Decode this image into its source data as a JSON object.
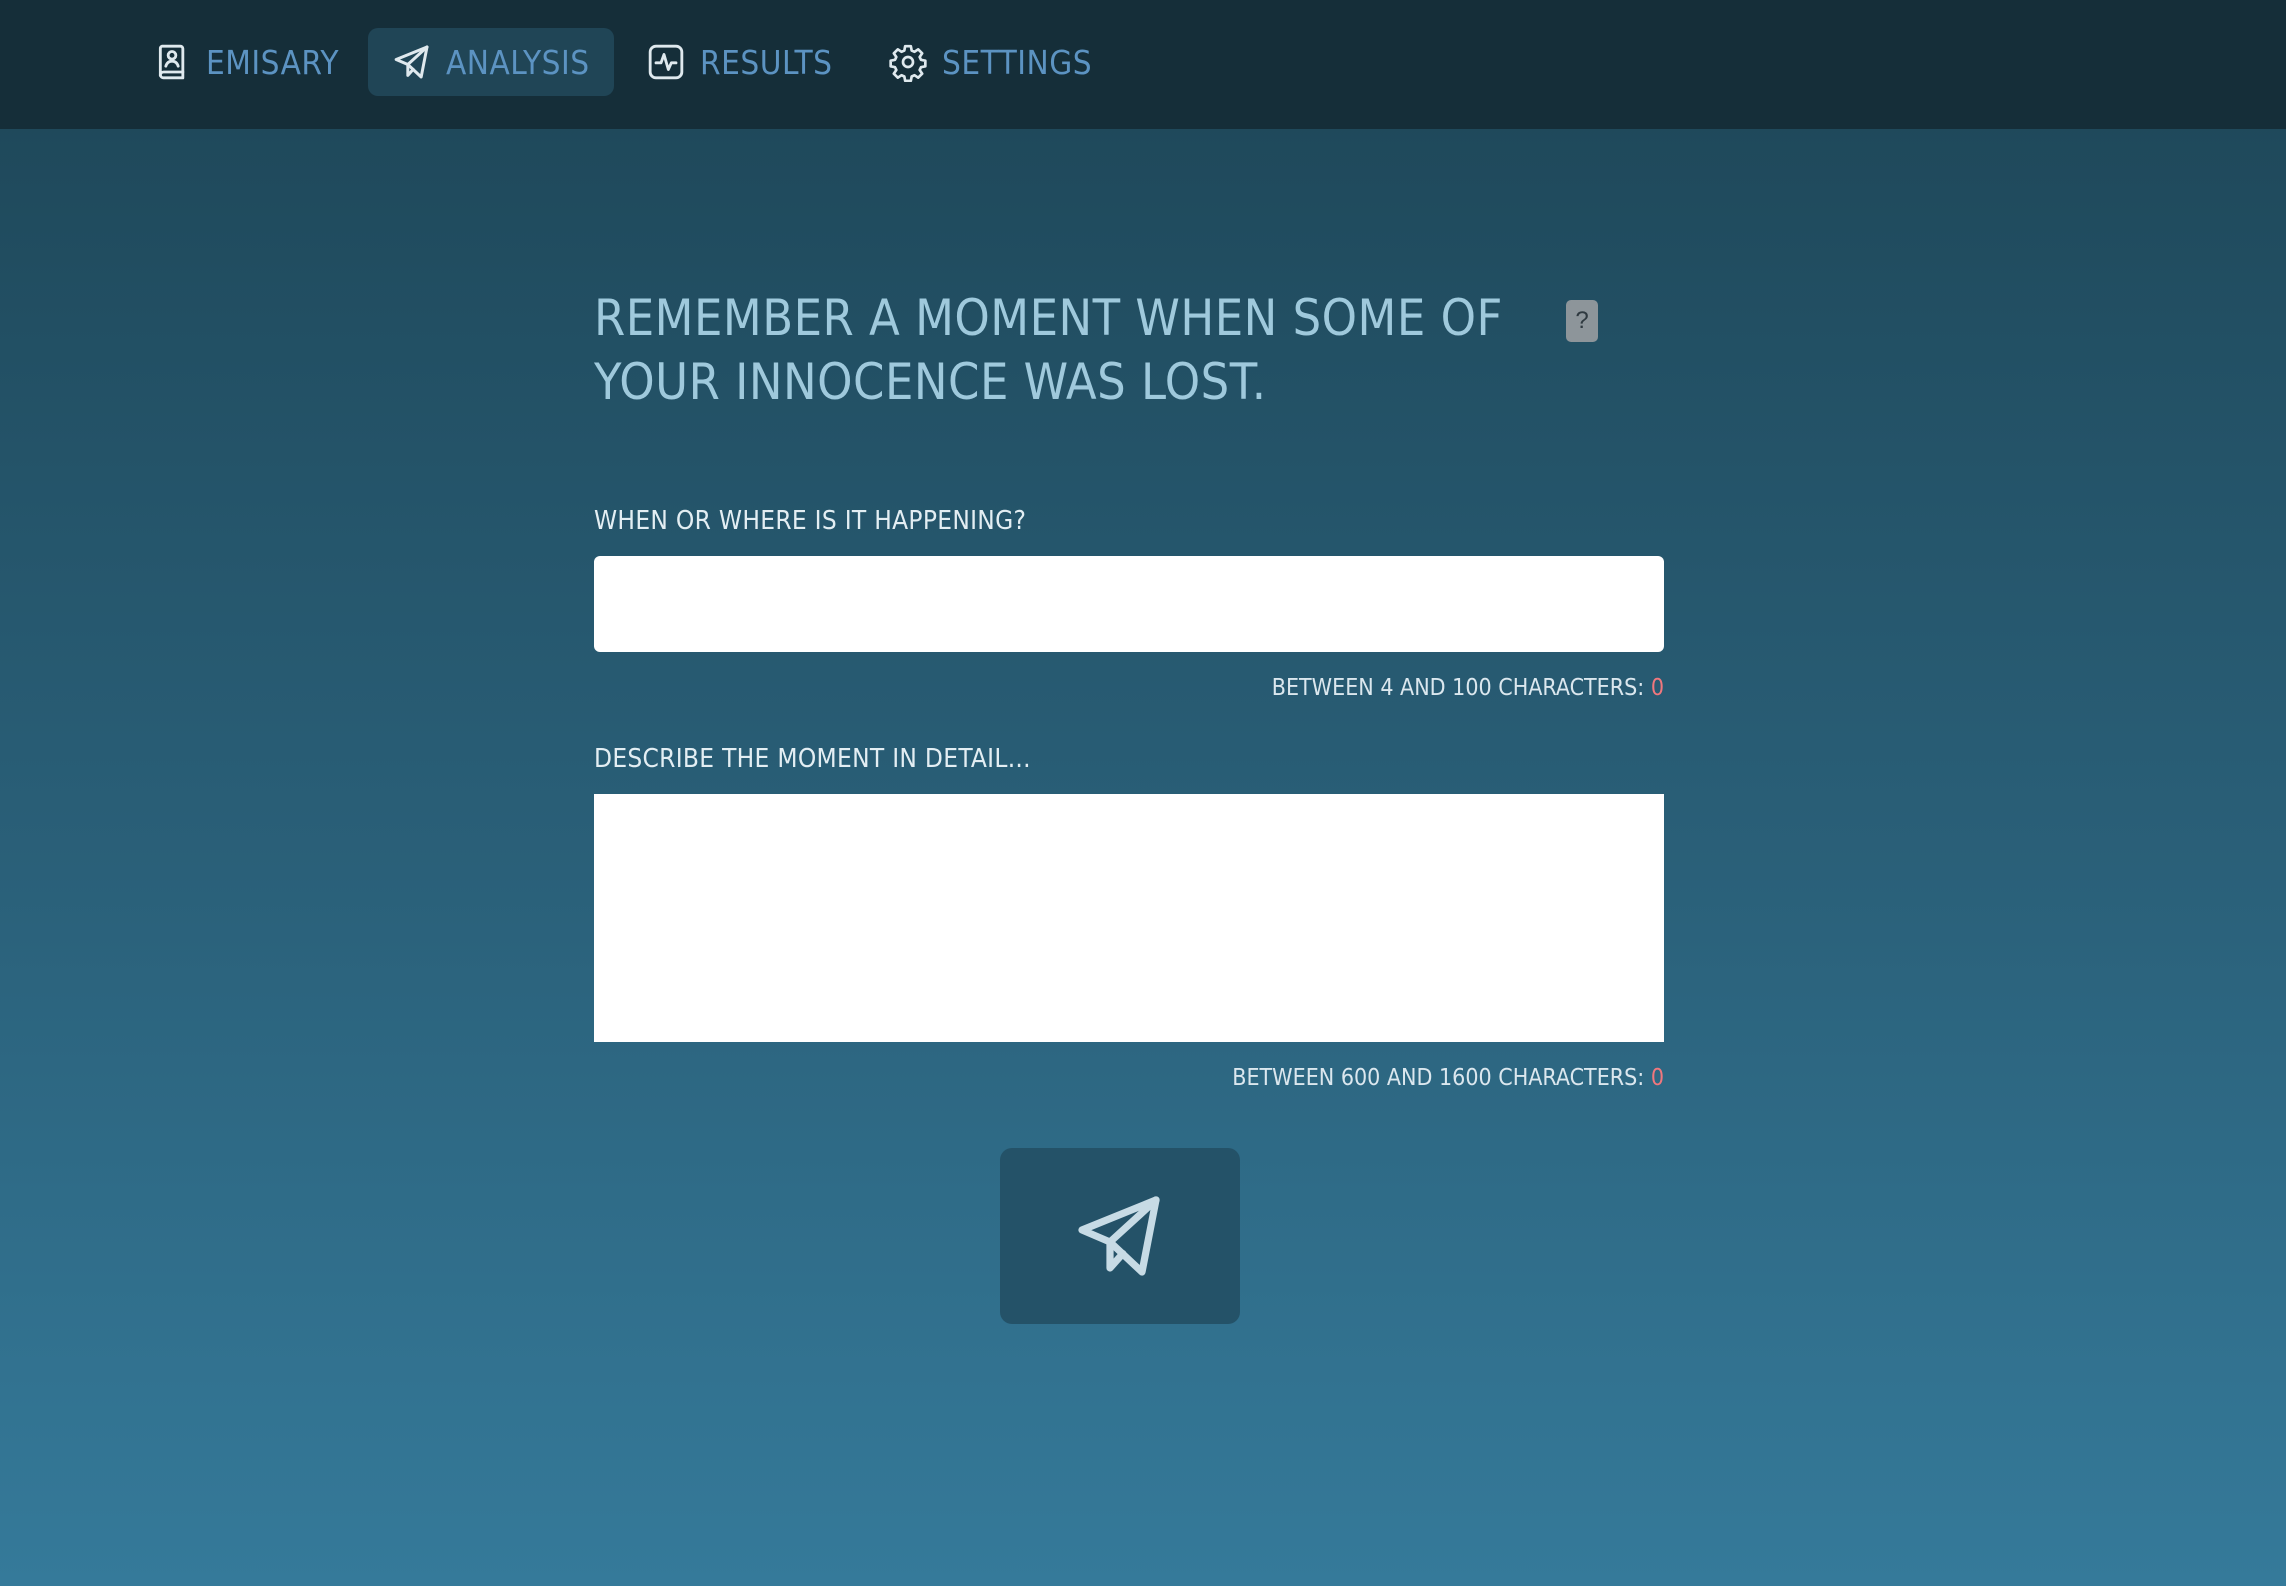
{
  "nav": {
    "items": [
      {
        "label": "EMISARY",
        "icon": "portrait-book-icon",
        "active": false
      },
      {
        "label": "ANALYSIS",
        "icon": "paper-plane-icon",
        "active": true
      },
      {
        "label": "RESULTS",
        "icon": "activity-icon",
        "active": false
      },
      {
        "label": "SETTINGS",
        "icon": "gear-icon",
        "active": false
      }
    ]
  },
  "prompt": {
    "title": "REMEMBER A MOMENT WHEN SOME OF YOUR INNOCENCE WAS LOST.",
    "help_label": "?"
  },
  "form": {
    "when_where": {
      "label": "WHEN OR WHERE IS IT HAPPENING?",
      "value": "",
      "placeholder": "",
      "hint": "BETWEEN 4 AND 100 CHARACTERS: ",
      "count": "0"
    },
    "description": {
      "label": "DESCRIBE THE MOMENT IN DETAIL...",
      "value": "",
      "placeholder": "",
      "hint": "BETWEEN 600 AND 1600 CHARACTERS: ",
      "count": "0"
    },
    "submit": {
      "icon": "paper-plane-icon"
    }
  },
  "colors": {
    "nav_background": "#152e39",
    "nav_active": "#204556",
    "nav_text": "#5c93c2",
    "title_text": "#9fc9dc",
    "count_text": "#f0777d",
    "submit_background": "#245268"
  }
}
